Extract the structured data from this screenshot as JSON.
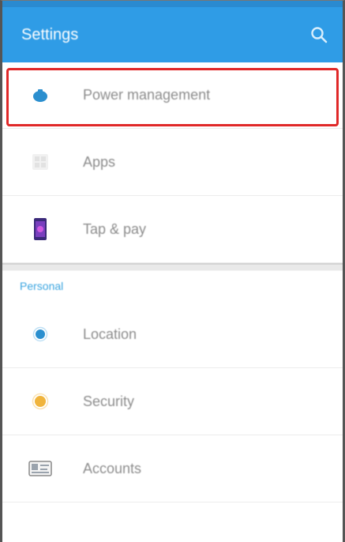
{
  "appbar": {
    "title": "Settings",
    "search_icon": "search-icon",
    "color": "#2f9ce6"
  },
  "highlight_color": "#e02828",
  "items": [
    {
      "label": "Power management",
      "icon": "power-icon",
      "highlighted": true
    },
    {
      "label": "Apps",
      "icon": "apps-icon"
    },
    {
      "label": "Tap & pay",
      "icon": "tap-pay-icon"
    }
  ],
  "section": {
    "header": "Personal",
    "header_color": "#3aa5e0"
  },
  "personal_items": [
    {
      "label": "Location",
      "icon": "location-icon"
    },
    {
      "label": "Security",
      "icon": "security-icon"
    },
    {
      "label": "Accounts",
      "icon": "accounts-icon"
    }
  ]
}
